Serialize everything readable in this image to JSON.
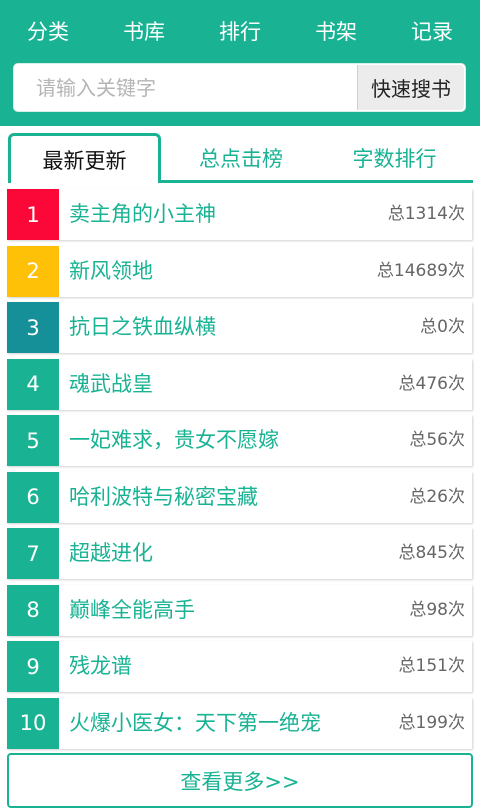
{
  "nav": {
    "items": [
      {
        "label": "分类"
      },
      {
        "label": "书库"
      },
      {
        "label": "排行"
      },
      {
        "label": "书架"
      },
      {
        "label": "记录"
      }
    ]
  },
  "search": {
    "placeholder": "请输入关键字",
    "button_label": "快速搜书"
  },
  "tabs": [
    {
      "label": "最新更新",
      "active": true
    },
    {
      "label": "总点击榜",
      "active": false
    },
    {
      "label": "字数排行",
      "active": false
    }
  ],
  "colors": {
    "brand": "#19b394",
    "rank1": "#fc0838",
    "rank2": "#fec107",
    "rank3": "#159099",
    "rank_default": "#19b394"
  },
  "books": [
    {
      "rank": "1",
      "title": "卖主角的小主神",
      "count": "总1314次"
    },
    {
      "rank": "2",
      "title": "新风领地",
      "count": "总14689次"
    },
    {
      "rank": "3",
      "title": "抗日之铁血纵横",
      "count": "总0次"
    },
    {
      "rank": "4",
      "title": "魂武战皇",
      "count": "总476次"
    },
    {
      "rank": "5",
      "title": "一妃难求，贵女不愿嫁",
      "count": "总56次"
    },
    {
      "rank": "6",
      "title": "哈利波特与秘密宝藏",
      "count": "总26次"
    },
    {
      "rank": "7",
      "title": "超越进化",
      "count": "总845次"
    },
    {
      "rank": "8",
      "title": "巅峰全能高手",
      "count": "总98次"
    },
    {
      "rank": "9",
      "title": "残龙谱",
      "count": "总151次"
    },
    {
      "rank": "10",
      "title": "火爆小医女：天下第一绝宠",
      "count": "总199次"
    }
  ],
  "more_label": "查看更多>>"
}
